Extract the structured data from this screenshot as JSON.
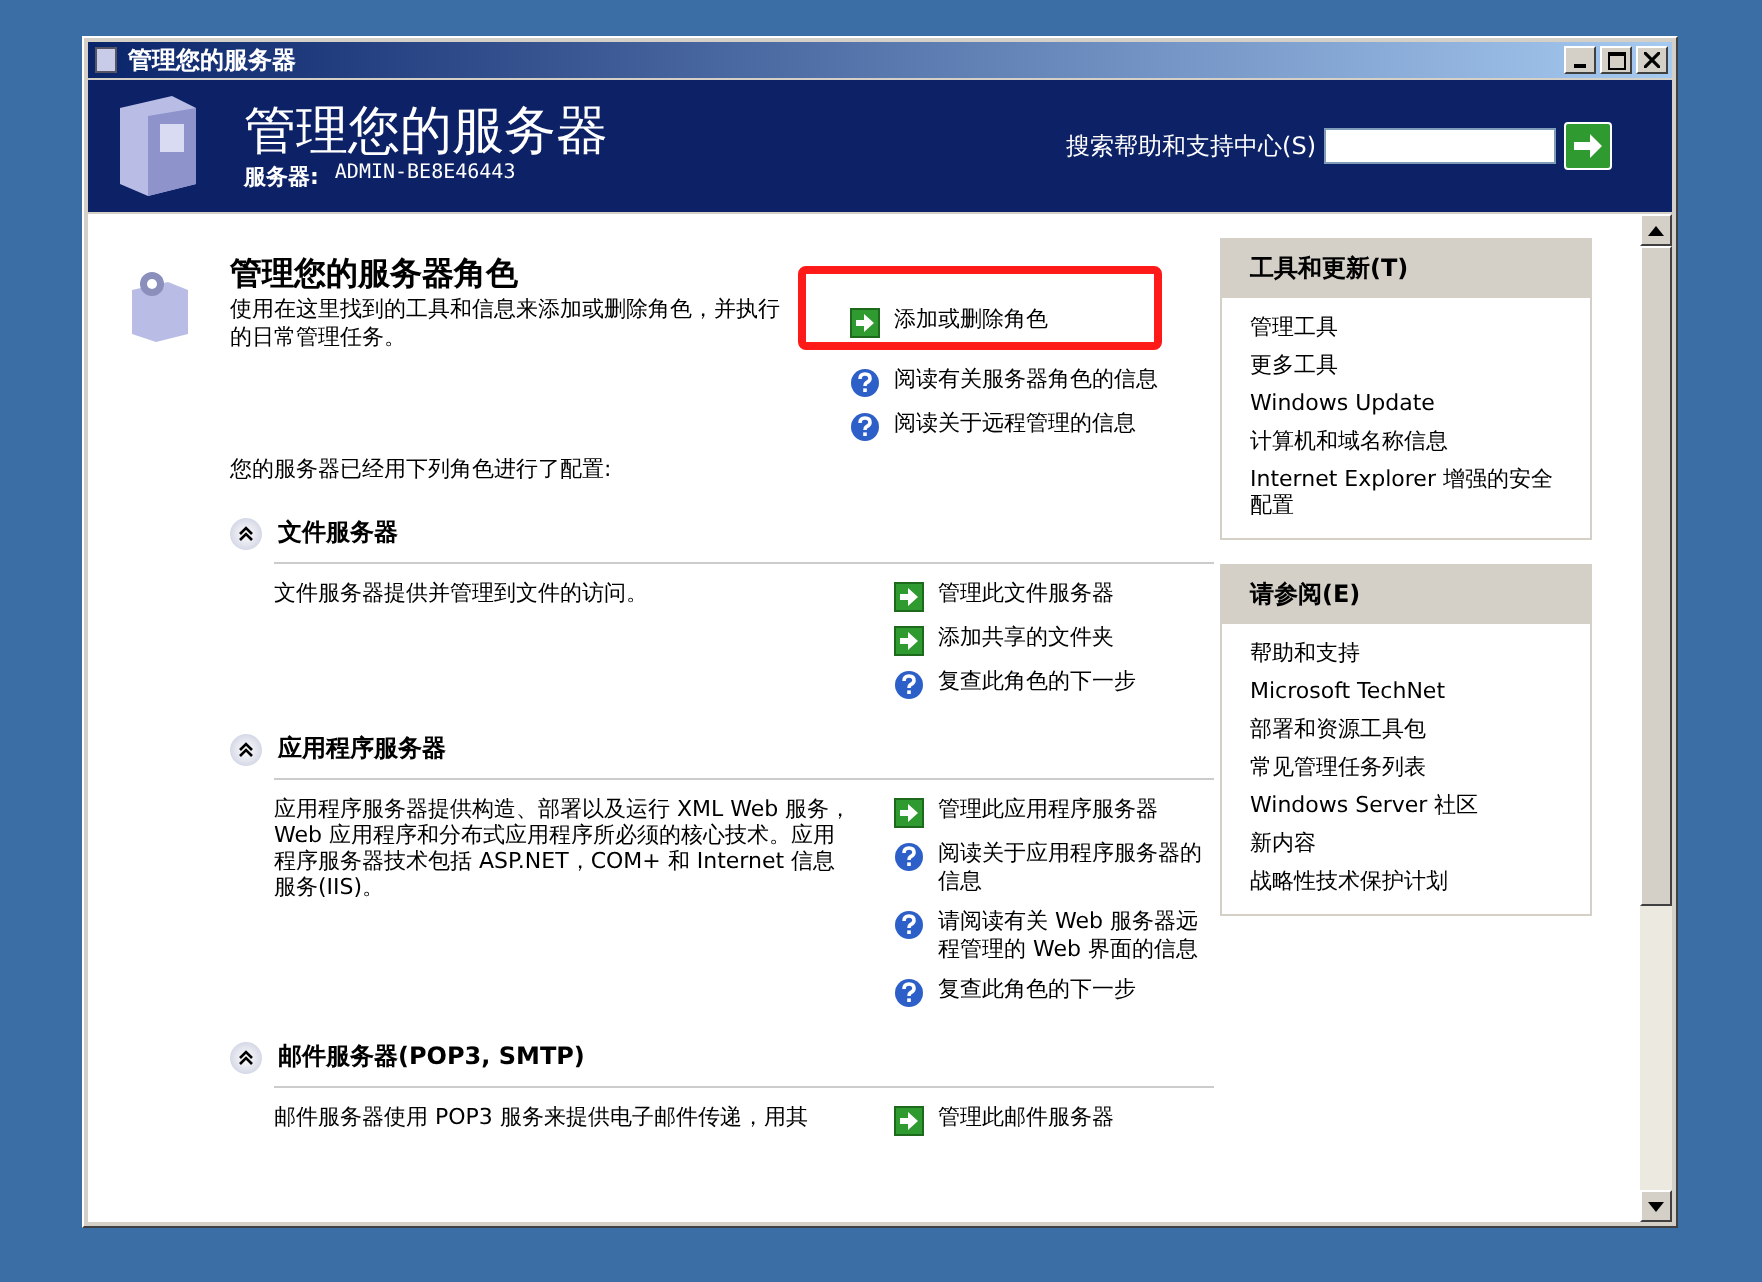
{
  "window": {
    "title": "管理您的服务器"
  },
  "header": {
    "title": "管理您的服务器",
    "server_label": "服务器:",
    "server_name": "ADMIN-BE8E46443",
    "search_label": "搜索帮助和支持中心(S)"
  },
  "intro": {
    "heading": "管理您的服务器角色",
    "description": "使用在这里找到的工具和信息来添加或删除角色，并执行",
    "description_2": "的日常管理任务。",
    "configured_text": "您的服务器已经用下列角色进行了配置:",
    "links": [
      {
        "kind": "arrow",
        "label": "添加或删除角色",
        "highlighted": true
      },
      {
        "kind": "help",
        "label": "阅读有关服务器角色的信息",
        "highlighted": false
      },
      {
        "kind": "help",
        "label": "阅读关于远程管理的信息",
        "highlighted": false
      }
    ]
  },
  "roles": [
    {
      "title": "文件服务器",
      "description": "文件服务器提供并管理到文件的访问。",
      "links": [
        {
          "kind": "arrow",
          "label": "管理此文件服务器"
        },
        {
          "kind": "arrow",
          "label": "添加共享的文件夹"
        },
        {
          "kind": "help",
          "label": "复查此角色的下一步"
        }
      ]
    },
    {
      "title": "应用程序服务器",
      "description": "应用程序服务器提供构造、部署以及运行 XML Web 服务，Web 应用程序和分布式应用程序所必须的核心技术。应用程序服务器技术包括 ASP.NET，COM+ 和 Internet 信息服务(IIS)。",
      "links": [
        {
          "kind": "arrow",
          "label": "管理此应用程序服务器"
        },
        {
          "kind": "help",
          "label": "阅读关于应用程序服务器的信息"
        },
        {
          "kind": "help",
          "label": "请阅读有关 Web 服务器远程管理的 Web 界面的信息"
        },
        {
          "kind": "help",
          "label": "复查此角色的下一步"
        }
      ]
    },
    {
      "title": "邮件服务器(POP3, SMTP)",
      "description": "邮件服务器使用 POP3 服务来提供电子邮件传递，用其",
      "links": [
        {
          "kind": "arrow",
          "label": "管理此邮件服务器"
        }
      ]
    }
  ],
  "sidebar": [
    {
      "title": "工具和更新(T)",
      "items": [
        "管理工具",
        "更多工具",
        "Windows Update",
        "计算机和域名称信息",
        "Internet Explorer 增强的安全配置"
      ]
    },
    {
      "title": "请参阅(E)",
      "items": [
        "帮助和支持",
        "Microsoft TechNet",
        "部署和资源工具包",
        "常见管理任务列表",
        "Windows Server 社区",
        "新内容",
        "战略性技术保护计划"
      ]
    }
  ]
}
